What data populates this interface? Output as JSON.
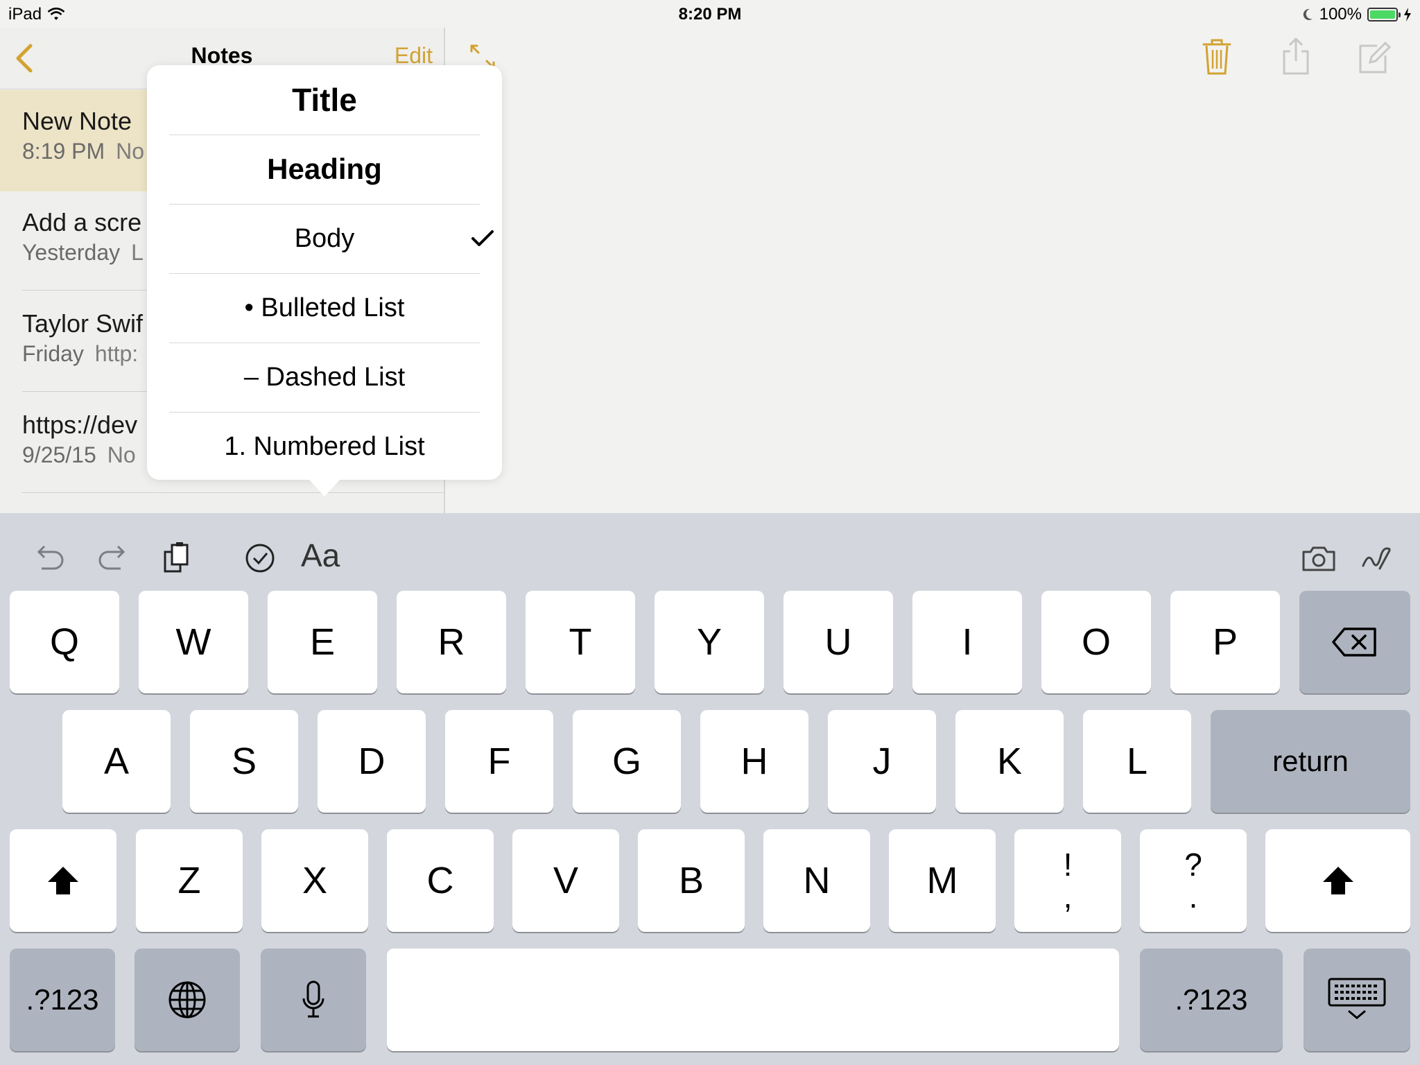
{
  "status": {
    "device": "iPad",
    "time": "8:20 PM",
    "battery": "100%"
  },
  "sidebar": {
    "title": "Notes",
    "edit_label": "Edit",
    "notes": [
      {
        "title": "New Note",
        "date": "8:19 PM",
        "preview": "No"
      },
      {
        "title": "Add a scre",
        "date": "Yesterday",
        "preview": "L"
      },
      {
        "title": "Taylor Swif",
        "date": "Friday",
        "preview": "http:"
      },
      {
        "title": "https://dev",
        "date": "9/25/15",
        "preview": "No"
      }
    ]
  },
  "popover": {
    "options": [
      {
        "label": "Title"
      },
      {
        "label": "Heading"
      },
      {
        "label": "Body",
        "selected": true
      },
      {
        "label": "• Bulleted List"
      },
      {
        "label": "– Dashed List"
      },
      {
        "label": "1. Numbered List"
      }
    ]
  },
  "keyboard": {
    "format_label": "Aa",
    "row1": [
      "Q",
      "W",
      "E",
      "R",
      "T",
      "Y",
      "U",
      "I",
      "O",
      "P"
    ],
    "row2": [
      "A",
      "S",
      "D",
      "F",
      "G",
      "H",
      "J",
      "K",
      "L"
    ],
    "return_label": "return",
    "row3": [
      "Z",
      "X",
      "C",
      "V",
      "B",
      "N",
      "M"
    ],
    "punct1": [
      "!",
      ","
    ],
    "punct2": [
      "?",
      "."
    ],
    "numbers_label": ".?123"
  },
  "colors": {
    "accent": "#d3a230",
    "selected_note": "#ede3c6",
    "keyboard_bg": "#d3d6dd",
    "battery": "#4cd964"
  },
  "icons": [
    "back-chevron-icon",
    "expand-icon",
    "trash-icon",
    "share-icon",
    "compose-icon",
    "undo-icon",
    "redo-icon",
    "paste-icon",
    "checklist-icon",
    "camera-icon",
    "sketch-icon",
    "delete-icon",
    "shift-icon",
    "globe-icon",
    "mic-icon",
    "keyboard-dismiss-icon"
  ]
}
